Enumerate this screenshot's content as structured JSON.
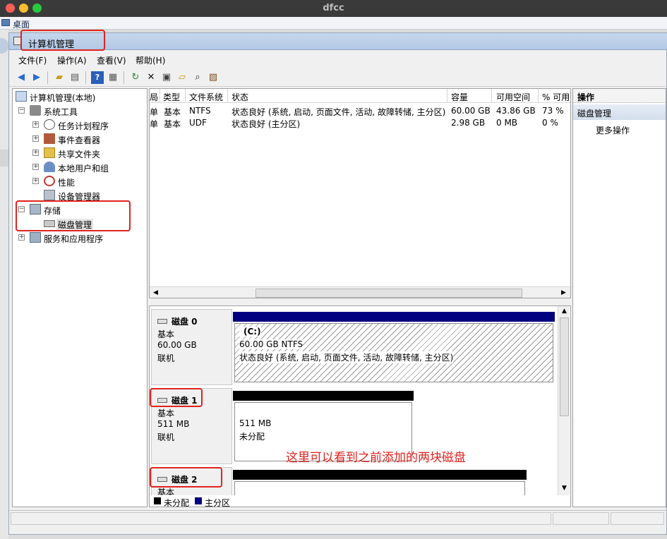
{
  "host_window": {
    "title": "dfcc"
  },
  "remote": {
    "desktop_label": "桌面"
  },
  "window": {
    "title": "计算机管理"
  },
  "menu": [
    "文件(F)",
    "操作(A)",
    "查看(V)",
    "帮助(H)"
  ],
  "toolbar_icons": [
    "back-icon",
    "forward-icon",
    "up-folder-icon",
    "show-hide-tree-icon",
    "help-icon",
    "properties-icon",
    "refresh-icon",
    "delete-icon",
    "properties-sheet-icon",
    "open-icon",
    "search-icon",
    "export-icon"
  ],
  "tree": {
    "root": "计算机管理(本地)",
    "system_tools": "系统工具",
    "task_scheduler": "任务计划程序",
    "event_viewer": "事件查看器",
    "shared_folders": "共享文件夹",
    "local_users": "本地用户和组",
    "performance": "性能",
    "device_manager": "设备管理器",
    "storage": "存储",
    "disk_management": "磁盘管理",
    "services_apps": "服务和应用程序"
  },
  "volumes": {
    "columns": [
      "局",
      "类型",
      "文件系统",
      "状态",
      "容量",
      "可用空间",
      "% 可用"
    ],
    "rows": [
      {
        "layout": "单",
        "type": "基本",
        "fs": "NTFS",
        "status": "状态良好 (系统, 启动, 页面文件, 活动, 故障转储, 主分区)",
        "capacity": "60.00 GB",
        "free": "43.86 GB",
        "pct": "73 %"
      },
      {
        "layout": "单",
        "type": "基本",
        "fs": "UDF",
        "status": "状态良好 (主分区)",
        "capacity": "2.98 GB",
        "free": "0 MB",
        "pct": "0 %"
      }
    ]
  },
  "disks": [
    {
      "name": "磁盘 0",
      "type": "基本",
      "size": "60.00 GB",
      "state": "联机",
      "part_name": "(C:)",
      "part_size": "60.00 GB NTFS",
      "part_status": "状态良好 (系统, 启动, 页面文件, 活动, 故障转储, 主分区)"
    },
    {
      "name": "磁盘 1",
      "type": "基本",
      "size": "511 MB",
      "state": "联机",
      "part_size": "511 MB",
      "part_status": "未分配"
    },
    {
      "name": "磁盘 2",
      "type": "基本"
    }
  ],
  "legend": {
    "unallocated": "未分配",
    "primary": "主分区"
  },
  "actions": {
    "header": "操作",
    "section": "磁盘管理",
    "more": "更多操作"
  },
  "annotation": "这里可以看到之前添加的两块磁盘",
  "colors": {
    "primary_partition": "#000080",
    "unallocated": "#000000",
    "highlight": "#e0231f"
  }
}
